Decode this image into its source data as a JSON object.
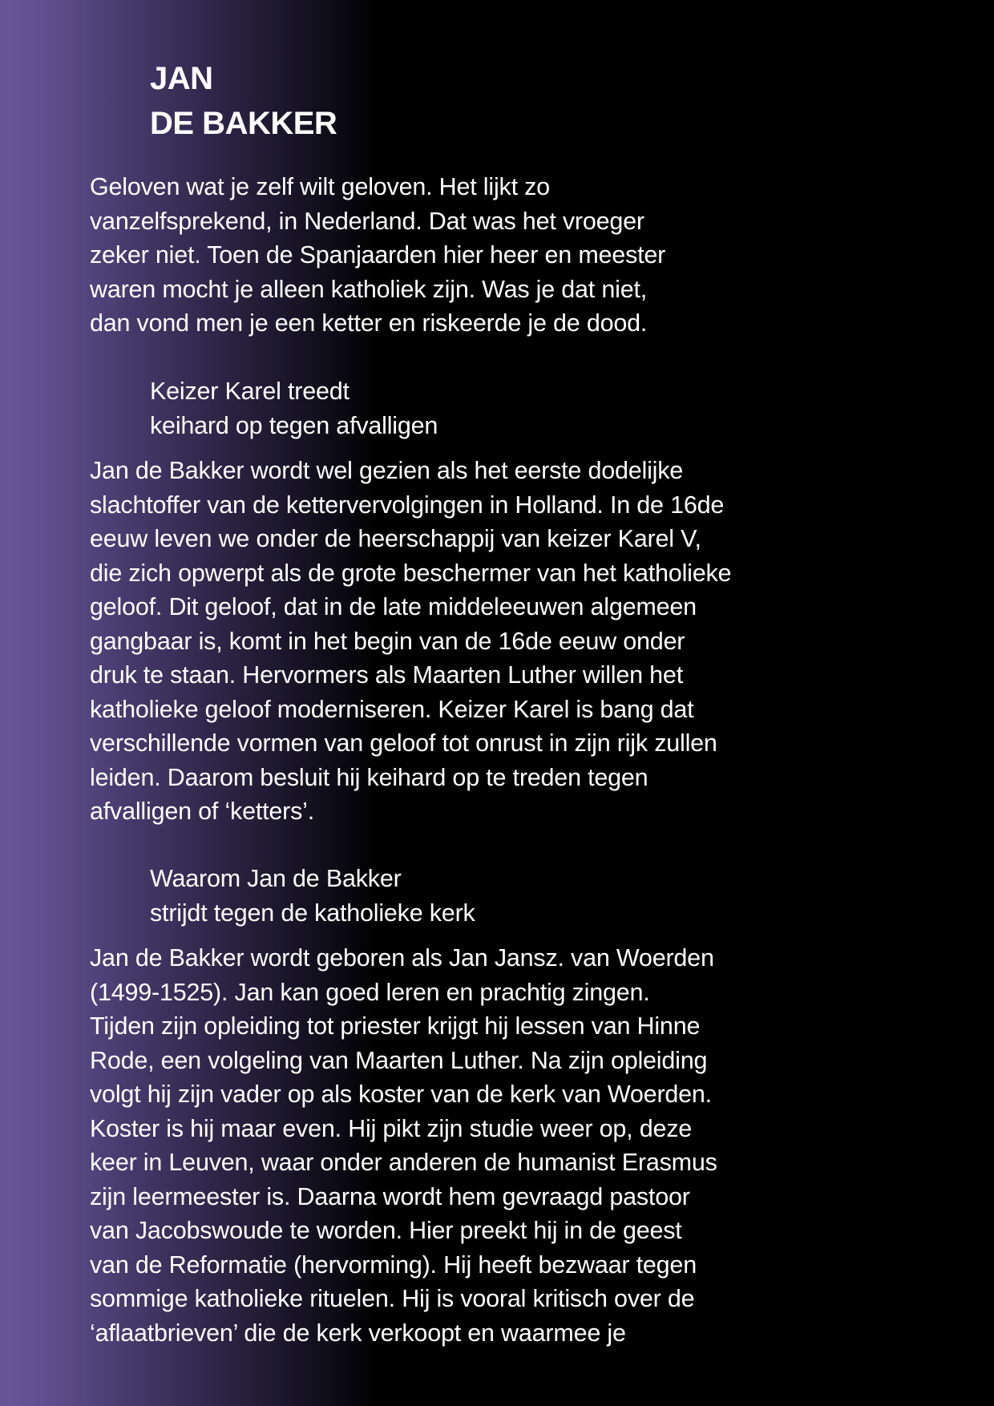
{
  "title": {
    "line1": "JAN",
    "line2": "DE BAKKER"
  },
  "paragraph1": [
    "Geloven wat je zelf wilt geloven. Het lijkt zo",
    "vanzelfsprekend, in Nederland. Dat was het vroeger",
    "zeker niet. Toen de Spanjaarden hier heer en meester",
    "waren mocht je alleen katholiek zijn. Was je dat niet,",
    "dan vond men je een ketter en riskeerde je de dood."
  ],
  "subheading1": [
    "Keizer Karel treedt",
    "keihard op tegen afvalligen"
  ],
  "paragraph2": [
    "Jan de Bakker wordt wel gezien als het eerste dodelijke",
    "slachtoffer van de kettervervolgingen in Holland. In de 16de",
    "eeuw leven we onder de heerschappij van keizer Karel V,",
    "die zich opwerpt als de grote beschermer van het katholieke",
    "geloof. Dit geloof, dat in de late middeleeuwen algemeen",
    "gangbaar is, komt in het begin van de 16de eeuw onder",
    "druk te staan. Hervormers als Maarten Luther willen het",
    "katholieke geloof moderniseren. Keizer Karel is bang dat",
    "verschillende vormen van geloof tot onrust in zijn rijk zullen",
    "leiden. Daarom besluit hij keihard op te treden tegen",
    "afvalligen of ‘ketters’."
  ],
  "subheading2": [
    "Waarom Jan de Bakker",
    "strijdt tegen de katholieke kerk"
  ],
  "paragraph3": [
    "Jan de Bakker wordt geboren als Jan Jansz. van Woerden",
    "(1499-1525). Jan kan goed leren en prachtig zingen.",
    "Tijden zijn opleiding tot priester krijgt hij lessen van Hinne",
    "Rode, een volgeling van Maarten Luther. Na zijn opleiding",
    "volgt hij zijn vader op als koster van de kerk van Woerden.",
    "Koster is hij maar even. Hij pikt zijn studie weer op, deze",
    "keer in Leuven, waar onder anderen de humanist Erasmus",
    "zijn leermeester is. Daarna wordt hem gevraagd pastoor",
    "van Jacobswoude te worden. Hier preekt hij in de geest",
    "van de Reformatie (hervorming). Hij heeft bezwaar tegen",
    "sommige katholieke rituelen. Hij is vooral kritisch over de",
    "‘aflaatbrieven’ die de kerk verkoopt en waarmee je"
  ],
  "colors": {
    "background": "#000000",
    "gradient_left": "#675598",
    "text": "#ffffff"
  }
}
